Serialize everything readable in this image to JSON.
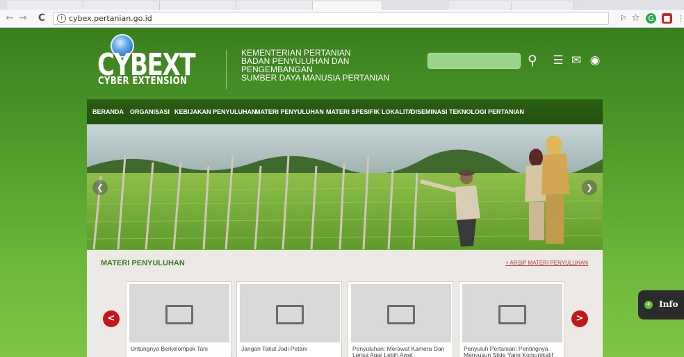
{
  "browser": {
    "url": "cybex.pertanian.go.id",
    "back": "←",
    "forward": "→",
    "reload": "C",
    "info_icon": "i",
    "star": "☆"
  },
  "header": {
    "logo_main": "CYBEXT",
    "logo_sub": "CYBER EXTENSION",
    "ministry_lines": [
      "KEMENTERIAN PERTANIAN",
      "BADAN PENYULUHAN DAN",
      "PENGEMBANGAN",
      "SUMBER DAYA MANUSIA PERTANIAN"
    ]
  },
  "nav": {
    "items": [
      "BERANDA",
      "ORGANISASI",
      "KEBIJAKAN PENYULUHAN",
      "MATERI PENYULUHAN",
      "MATERI SPESIFIK LOKALITA",
      "DISEMINASI TEKNOLOGI PERTANIAN"
    ]
  },
  "materi": {
    "title": "MATERI PENYULUHAN",
    "archive_link": "+ ARSIP MATERI PENYULUHAN",
    "prev": "<",
    "next": ">",
    "cards": [
      "Untungnya Berkelompok Tani",
      "Jangan Takut Jadi Petani",
      "Penyuluhan: Merawat Kamera Dan Lensa Agar Lebih Awet",
      "Penyuluh Pertanian: Pentingnya Menyusun Slide Yang Komunikatif"
    ]
  },
  "info_button": {
    "label": "Info"
  },
  "colors": {
    "page_green": "#4f9a2a",
    "nav_green": "#23520f",
    "accent_red": "#c0171c",
    "title_green": "#3b7a20"
  }
}
